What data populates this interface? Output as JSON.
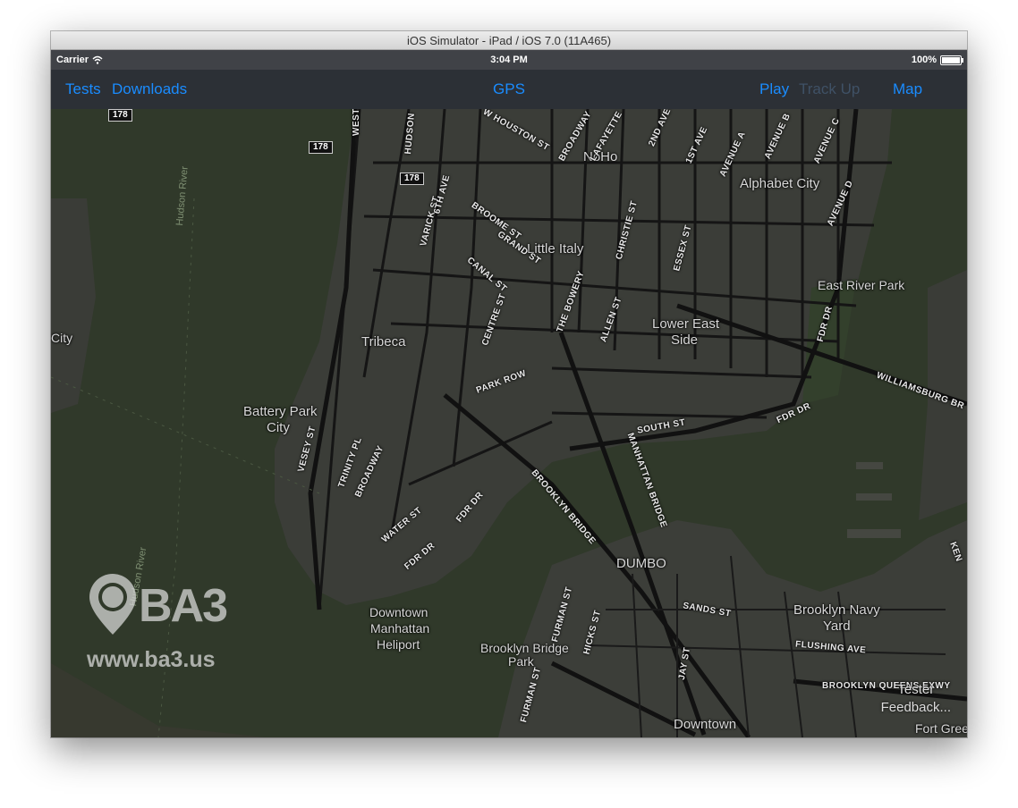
{
  "window": {
    "title": "iOS Simulator - iPad / iOS 7.0 (11A465)"
  },
  "statusbar": {
    "carrier": "Carrier",
    "time": "3:04 PM",
    "battery": "100%"
  },
  "navbar": {
    "tests": "Tests",
    "downloads": "Downloads",
    "title": "GPS",
    "play": "Play",
    "track_up": "Track Up",
    "map": "Map",
    "accent_color": "#1a8cff"
  },
  "map": {
    "shields": [
      "178",
      "178",
      "178"
    ],
    "neighborhoods": {
      "noho": "NoHo",
      "alphabet_city": "Alphabet City",
      "little_italy": "Little Italy",
      "east_river_park": "East River Park",
      "tribeca": "Tribeca",
      "lower_east_side_1": "Lower East",
      "lower_east_side_2": "Side",
      "battery_park_1": "Battery Park",
      "battery_park_2": "City",
      "dumbo": "DUMBO",
      "heliport_1": "Downtown",
      "heliport_2": "Manhattan",
      "heliport_3": "Heliport",
      "bb_park_1": "Brooklyn Bridge",
      "bb_park_2": "Park",
      "navy_yard_1": "Brooklyn Navy",
      "navy_yard_2": "Yard",
      "city": "City",
      "downtown": "Downtown",
      "fort_greene": "Fort Gree"
    },
    "water": {
      "hudson_1": "Hudson River",
      "hudson_2": "Hudson River"
    },
    "streets": {
      "west": "WEST",
      "hudson": "HUDSON",
      "houston": "W HOUSTON ST",
      "broadway": "BROADWAY",
      "lafayette": "LAFAYETTE",
      "second_ave": "2ND AVE",
      "first_ave": "1ST AVE",
      "ave_a": "AVENUE A",
      "ave_b": "AVENUE B",
      "ave_c": "AVENUE C",
      "ave_d": "AVENUE D",
      "varick": "VARICK ST",
      "sixth_ave": "6TH AVE",
      "broome": "BROOME ST",
      "grand": "GRAND ST",
      "canal": "CANAL ST",
      "christie": "CHRISTIE ST",
      "essex": "ESSEX ST",
      "centre": "CENTRE ST",
      "bowery": "THE BOWERY",
      "allen": "ALLEN ST",
      "fdr1": "FDR DR",
      "fdr2": "FDR DR",
      "fdr3": "FDR DR",
      "fdr4": "FDR DR",
      "williamsburg": "WILLIAMSBURG BR",
      "park_row": "PARK ROW",
      "south": "SOUTH ST",
      "vesey": "VESEY ST",
      "trinity": "TRINITY PL",
      "broadway2": "BROADWAY",
      "manhattan_bridge": "MANHATTAN BRIDGE",
      "brooklyn_bridge": "BROOKLYN BRIDGE",
      "water_st": "WATER ST",
      "furman": "FURMAN ST",
      "furman2": "FURMAN ST",
      "hicks": "HICKS ST",
      "sands": "SANDS ST",
      "jay": "JAY ST",
      "flushing": "FLUSHING AVE",
      "bqe": "BROOKLYN QUEENS EXWY",
      "ken": "KEN"
    },
    "logo_text": "BA3",
    "logo_url": "www.ba3.us",
    "tester_line1": "Tester",
    "tester_line2": "Feedback..."
  }
}
